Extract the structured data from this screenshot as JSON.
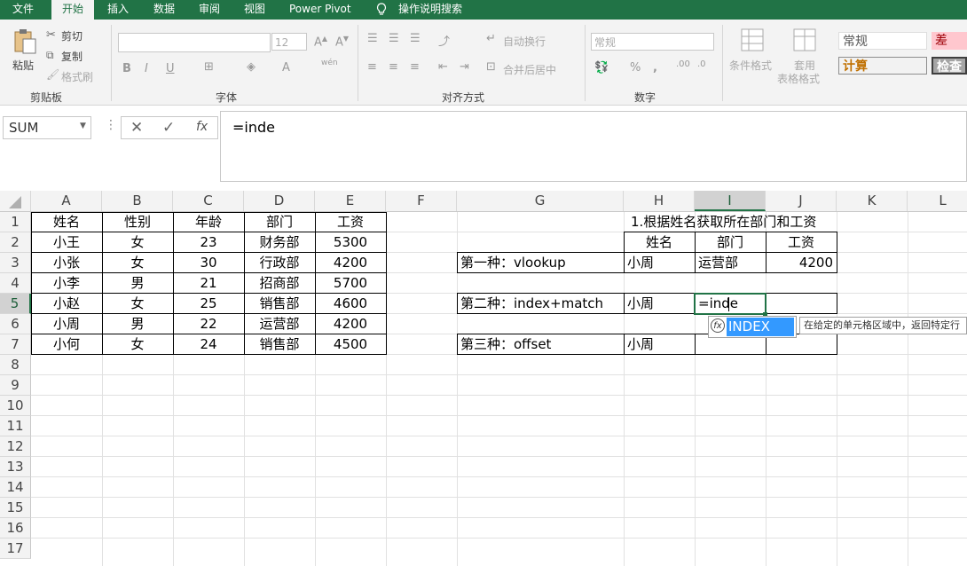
{
  "menu": {
    "file": "文件",
    "home": "开始",
    "insert": "插入",
    "data": "数据",
    "review": "审阅",
    "view": "视图",
    "powerpivot": "Power Pivot",
    "tellme": "操作说明搜索"
  },
  "ribbon": {
    "clipboard": {
      "paste": "粘贴",
      "cut": "剪切",
      "copy": "复制",
      "format_painter": "格式刷",
      "label": "剪贴板"
    },
    "font": {
      "size": "12",
      "bold": "B",
      "italic": "I",
      "underline": "U",
      "wen": "wén",
      "label": "字体"
    },
    "alignment": {
      "wrap": "自动换行",
      "merge": "合并后居中",
      "label": "对齐方式"
    },
    "number": {
      "format": "常规",
      "label": "数字"
    },
    "styles": {
      "conditional": "条件格式",
      "table_line1": "套用",
      "table_line2": "表格格式",
      "normal": "常规",
      "bad": "差",
      "calc": "计算",
      "check": "检查"
    }
  },
  "formula_bar": {
    "name_box": "SUM",
    "content": "=inde"
  },
  "columns": [
    "A",
    "B",
    "C",
    "D",
    "E",
    "F",
    "G",
    "H",
    "I",
    "J",
    "K",
    "L"
  ],
  "rows": [
    "1",
    "2",
    "3",
    "4",
    "5",
    "6",
    "7",
    "8",
    "9",
    "10",
    "11",
    "12",
    "13",
    "14",
    "15",
    "16",
    "17"
  ],
  "table1": {
    "headers": [
      "姓名",
      "性别",
      "年龄",
      "部门",
      "工资"
    ],
    "rows": [
      [
        "小王",
        "女",
        "23",
        "财务部",
        "5300"
      ],
      [
        "小张",
        "女",
        "30",
        "行政部",
        "4200"
      ],
      [
        "小李",
        "男",
        "21",
        "招商部",
        "5700"
      ],
      [
        "小赵",
        "女",
        "25",
        "销售部",
        "4600"
      ],
      [
        "小周",
        "男",
        "22",
        "运营部",
        "4200"
      ],
      [
        "小何",
        "女",
        "24",
        "销售部",
        "4500"
      ]
    ]
  },
  "table2": {
    "title": "1.根据姓名获取所在部门和工资",
    "headers": [
      "姓名",
      "部门",
      "工资"
    ],
    "rows": [
      {
        "method": "第一种：vlookup",
        "name": "小周",
        "dept": "运营部",
        "salary": "4200"
      },
      {
        "method": "第二种：index+match",
        "name": "小周",
        "dept": "=inde",
        "salary": ""
      },
      {
        "method": "第三种：offset",
        "name": "小周",
        "dept": "",
        "salary": ""
      }
    ]
  },
  "autocomplete": {
    "item": "INDEX",
    "tooltip": "在给定的单元格区域中，返回特定行"
  },
  "colors": {
    "accent": "#217346",
    "selection": "#3399ff"
  }
}
